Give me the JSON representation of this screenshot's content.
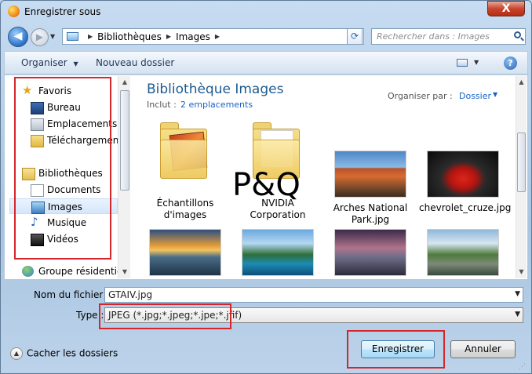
{
  "window": {
    "title": "Enregistrer sous",
    "close_label": "X"
  },
  "address": {
    "crumbs": [
      "Bibliothèques",
      "Images"
    ]
  },
  "search": {
    "placeholder": "Rechercher dans : Images"
  },
  "toolbar": {
    "organize": "Organiser",
    "new_folder": "Nouveau dossier",
    "help": "?"
  },
  "nav": {
    "favorites": "Favoris",
    "fav_items": [
      "Bureau",
      "Emplacements récents",
      "Téléchargements"
    ],
    "libraries": "Bibliothèques",
    "lib_items": [
      "Documents",
      "Images",
      "Musique",
      "Vidéos"
    ],
    "homegroup": "Groupe résidentiel"
  },
  "content": {
    "title": "Bibliothèque Images",
    "include_label": "Inclut :",
    "include_link": "2 emplacements",
    "arrange_label": "Organiser par :",
    "arrange_value": "Dossier",
    "watermark": "P&Q",
    "tiles": [
      {
        "label": "Échantillons d'images",
        "kind": "folder"
      },
      {
        "label": "NVIDIA Corporation",
        "kind": "folder"
      },
      {
        "label": "Arches National Park.jpg",
        "kind": "image"
      },
      {
        "label": "chevrolet_cruze.jpg",
        "kind": "image"
      },
      {
        "label": "",
        "kind": "image"
      },
      {
        "label": "",
        "kind": "image"
      },
      {
        "label": "",
        "kind": "image"
      },
      {
        "label": "",
        "kind": "image"
      }
    ]
  },
  "form": {
    "filename_label": "Nom du fichier :",
    "filename_value": "GTAIV.jpg",
    "type_label": "Type :",
    "type_value": "JPEG (*.jpg;*.jpeg;*.jpe;*.jfif)"
  },
  "footer": {
    "hide_folders": "Cacher les dossiers",
    "save": "Enregistrer",
    "cancel": "Annuler"
  },
  "colors": {
    "annotation": "#d6262a",
    "link": "#1a63c4",
    "title": "#1e5b8f"
  }
}
